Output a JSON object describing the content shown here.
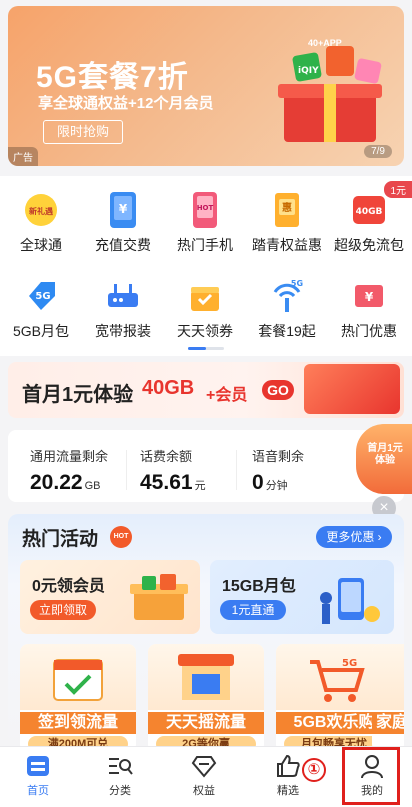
{
  "banner": {
    "title": "5G套餐7折",
    "subtitle": "享全球通权益+12个月会员",
    "button": "限时抢购",
    "ad_label": "广告",
    "page_indicator": "7/9"
  },
  "grid": {
    "items": [
      {
        "label": "全球通",
        "icon": "new-gift-icon",
        "badge": "新礼遇"
      },
      {
        "label": "充值交费",
        "icon": "phone-yuan-icon"
      },
      {
        "label": "热门手机",
        "icon": "hot-phone-icon",
        "badge": "HOT"
      },
      {
        "label": "踏青权益惠",
        "icon": "benefit-card-icon",
        "badge": "惠"
      },
      {
        "label": "超级免流包",
        "icon": "40gb-package-icon",
        "badge": "40GB"
      },
      {
        "label": "5GB月包",
        "icon": "5g-tag-icon",
        "badge": "5G"
      },
      {
        "label": "宽带报装",
        "icon": "router-icon"
      },
      {
        "label": "天天领券",
        "icon": "coupon-gift-icon"
      },
      {
        "label": "套餐19起",
        "icon": "5g-signal-icon",
        "badge": "5G"
      },
      {
        "label": "热门优惠",
        "icon": "discount-ticket-icon"
      }
    ],
    "corner_badge": "1元"
  },
  "promo": {
    "text1": "首月1元体验",
    "text2": "40GB",
    "text3": "+会员",
    "go": "GO",
    "image_label": "40+APP"
  },
  "balance": {
    "items": [
      {
        "label": "通用流量剩余",
        "value": "20.22",
        "unit": "GB"
      },
      {
        "label": "话费余额",
        "value": "45.61",
        "unit": "元"
      },
      {
        "label": "语音剩余",
        "value": "0",
        "unit": "分钟"
      }
    ],
    "float_promo": "首月1元体验"
  },
  "hot": {
    "title": "热门活动",
    "badge": "HOT",
    "more": "更多优惠 ›",
    "card_a": {
      "title": "0元领会员",
      "button": "立即领取"
    },
    "card_b": {
      "title": "15GB月包",
      "button": "1元直通"
    },
    "tiles": [
      {
        "title": "签到领流量",
        "sub": "满200M可兑"
      },
      {
        "title": "天天摇流量",
        "sub": "2G等你赢"
      },
      {
        "title": "5GB欢乐购",
        "sub": "月包畅享无忧"
      },
      {
        "title": "家庭",
        "sub": ""
      }
    ]
  },
  "nav": {
    "items": [
      {
        "label": "首页",
        "icon": "home-icon",
        "active": true
      },
      {
        "label": "分类",
        "icon": "category-search-icon"
      },
      {
        "label": "权益",
        "icon": "diamond-icon"
      },
      {
        "label": "精选",
        "icon": "thumbs-up-icon"
      },
      {
        "label": "我的",
        "icon": "user-icon"
      }
    ],
    "annotation": "①"
  },
  "colors": {
    "accent": "#3a7cf2",
    "promo_red": "#e8352e",
    "highlight": "#e0201c"
  }
}
